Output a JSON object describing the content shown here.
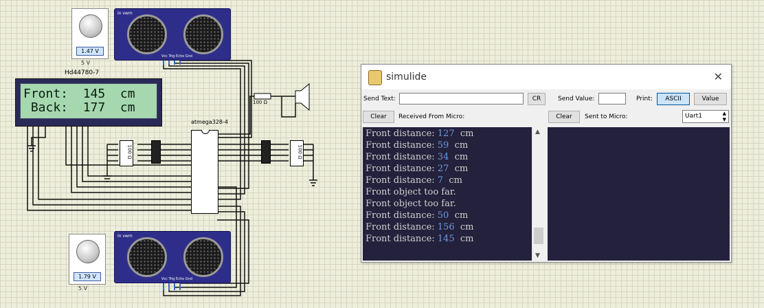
{
  "window": {
    "title": "simulide",
    "send_text_label": "Send Text:",
    "send_text_value": "",
    "cr_label": "CR",
    "send_value_label": "Send Value:",
    "send_value_value": "",
    "print_label": "Print:",
    "ascii_label": "ASCII",
    "value_label": "Value",
    "clear_left_label": "Clear",
    "received_label": "Received From Micro:",
    "clear_right_label": "Clear",
    "sent_label": "Sent to Micro:",
    "uart_selected": "Uart1"
  },
  "console_lines": [
    {
      "text": "Front distance: ",
      "num": "127",
      "unit": "  cm"
    },
    {
      "text": "Front distance: ",
      "num": "59",
      "unit": "  cm"
    },
    {
      "text": "Front distance: ",
      "num": "34",
      "unit": "  cm"
    },
    {
      "text": "Front distance: ",
      "num": "27",
      "unit": "  cm"
    },
    {
      "text": "Front distance: ",
      "num": "7",
      "unit": "  cm"
    },
    {
      "text": "Front object too far.",
      "num": "",
      "unit": ""
    },
    {
      "text": "Front object too far.",
      "num": "",
      "unit": ""
    },
    {
      "text": "Front distance: ",
      "num": "50",
      "unit": "  cm"
    },
    {
      "text": "Front distance: ",
      "num": "156",
      "unit": "  cm"
    },
    {
      "text": "Front distance: ",
      "num": "145",
      "unit": "  cm"
    }
  ],
  "circuit": {
    "pot_top_value": "1.47 V",
    "pot_top_supply": "5 V",
    "pot_bottom_value": "1.79 V",
    "pot_bottom_supply": "5 V",
    "sensor_label": "in vwm",
    "sensor_pins": "Vcc Trig Echo Gnd",
    "lcd_name": "Hd44780-7",
    "lcd_line1": "Front:  145  cm",
    "lcd_line2": " Back:  177  cm",
    "chip_name": "atmega328-4",
    "resistor_label": "100 Ω",
    "res_value": "100 Ω"
  },
  "colors": {
    "console_bg": "#24213c",
    "console_text": "#d0d0d0",
    "console_number": "#6b9be0",
    "sensor_body": "#2e2e8a",
    "lcd_screen": "#a6d8b0"
  }
}
